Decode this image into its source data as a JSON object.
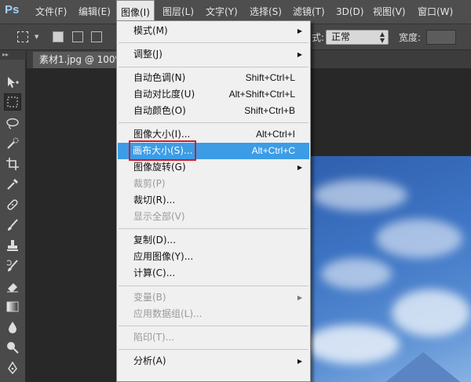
{
  "menubar": {
    "logo": "Ps",
    "items": [
      {
        "label": "文件(F)",
        "left": 0
      },
      {
        "label": "编辑(E)"
      },
      {
        "label": "图像(I)"
      },
      {
        "label": "图层(L)"
      },
      {
        "label": "文字(Y)"
      },
      {
        "label": "选择(S)"
      },
      {
        "label": "滤镜(T)"
      },
      {
        "label": "3D(D)"
      },
      {
        "label": "视图(V)"
      },
      {
        "label": "窗口(W)"
      }
    ]
  },
  "options_bar": {
    "style_label": "式:",
    "style_value": "正常",
    "width_label": "宽度:"
  },
  "document": {
    "tab_label": "素材1.jpg @ 100%"
  },
  "image_menu": {
    "items": [
      {
        "label": "模式(M)",
        "shortcut": "",
        "submenu": true,
        "disabled": false
      },
      {
        "label": "调整(J)",
        "shortcut": "",
        "submenu": true,
        "disabled": false
      },
      {
        "label": "自动色调(N)",
        "shortcut": "Shift+Ctrl+L",
        "submenu": false,
        "disabled": false
      },
      {
        "label": "自动对比度(U)",
        "shortcut": "Alt+Shift+Ctrl+L",
        "submenu": false,
        "disabled": false
      },
      {
        "label": "自动颜色(O)",
        "shortcut": "Shift+Ctrl+B",
        "submenu": false,
        "disabled": false
      },
      {
        "label": "图像大小(I)...",
        "shortcut": "Alt+Ctrl+I",
        "submenu": false,
        "disabled": false
      },
      {
        "label": "画布大小(S)...",
        "shortcut": "Alt+Ctrl+C",
        "submenu": false,
        "disabled": false,
        "highlighted": true
      },
      {
        "label": "图像旋转(G)",
        "shortcut": "",
        "submenu": true,
        "disabled": false
      },
      {
        "label": "裁剪(P)",
        "shortcut": "",
        "submenu": false,
        "disabled": true
      },
      {
        "label": "裁切(R)...",
        "shortcut": "",
        "submenu": false,
        "disabled": false
      },
      {
        "label": "显示全部(V)",
        "shortcut": "",
        "submenu": false,
        "disabled": true
      },
      {
        "label": "复制(D)...",
        "shortcut": "",
        "submenu": false,
        "disabled": false
      },
      {
        "label": "应用图像(Y)...",
        "shortcut": "",
        "submenu": false,
        "disabled": false
      },
      {
        "label": "计算(C)...",
        "shortcut": "",
        "submenu": false,
        "disabled": false
      },
      {
        "label": "变量(B)",
        "shortcut": "",
        "submenu": true,
        "disabled": true
      },
      {
        "label": "应用数据组(L)...",
        "shortcut": "",
        "submenu": false,
        "disabled": true
      },
      {
        "label": "陷印(T)...",
        "shortcut": "",
        "submenu": false,
        "disabled": true
      },
      {
        "label": "分析(A)",
        "shortcut": "",
        "submenu": true,
        "disabled": false
      }
    ]
  },
  "tools": [
    "move-tool",
    "marquee-tool",
    "lasso-tool",
    "quick-selection-tool",
    "crop-tool",
    "eyedropper-tool",
    "healing-brush-tool",
    "brush-tool",
    "clone-stamp-tool",
    "history-brush-tool",
    "eraser-tool",
    "gradient-tool",
    "blur-tool",
    "dodge-tool",
    "pen-tool"
  ],
  "colors": {
    "menu_highlight": "#3c9ce6",
    "annotation_box": "#d8192a"
  }
}
